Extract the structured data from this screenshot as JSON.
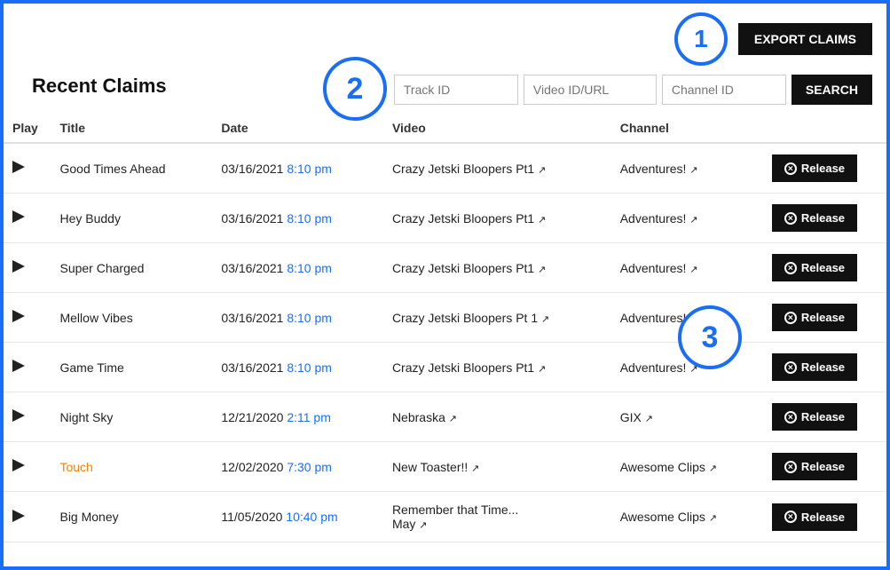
{
  "page": {
    "title": "Recent Claims",
    "badge1": "1",
    "badge2": "2",
    "badge3": "3"
  },
  "topbar": {
    "export_label": "EXPORT CLAIMS",
    "search_label": "SEARCH"
  },
  "search": {
    "track_id_placeholder": "Track ID",
    "video_id_placeholder": "Video ID/URL",
    "channel_id_placeholder": "Channel ID"
  },
  "table": {
    "headers": [
      "Play",
      "Title",
      "Date",
      "Video",
      "Channel",
      ""
    ],
    "rows": [
      {
        "title": "Good Times Ahead",
        "title_color": "normal",
        "date_part1": "03/16/2021",
        "date_part2": "8:10 pm",
        "video_line1": "Crazy Jetski Bloopers Pt1",
        "channel": "Adventures!",
        "action": "Release"
      },
      {
        "title": "Hey Buddy",
        "title_color": "normal",
        "date_part1": "03/16/2021",
        "date_part2": "8:10 pm",
        "video_line1": "Crazy Jetski Bloopers Pt1",
        "channel": "Adventures!",
        "action": "Release"
      },
      {
        "title": "Super Charged",
        "title_color": "normal",
        "date_part1": "03/16/2021",
        "date_part2": "8:10 pm",
        "video_line1": "Crazy Jetski Bloopers Pt1",
        "channel": "Adventures!",
        "action": "Release"
      },
      {
        "title": "Mellow Vibes",
        "title_color": "normal",
        "date_part1": "03/16/2021",
        "date_part2": "8:10 pm",
        "video_line1": "Crazy Jetski Bloopers Pt 1",
        "channel": "Adventures!",
        "action": "Release"
      },
      {
        "title": "Game Time",
        "title_color": "normal",
        "date_part1": "03/16/2021",
        "date_part2": "8:10 pm",
        "video_line1": "Crazy Jetski Bloopers Pt1",
        "channel": "Adventures!",
        "action": "Release"
      },
      {
        "title": "Night Sky",
        "title_color": "normal",
        "date_part1": "12/21/2020",
        "date_part2": "2:11 pm",
        "video_line1": "Nebraska",
        "channel": "GIX",
        "action": "Release"
      },
      {
        "title": "Touch",
        "title_color": "orange",
        "date_part1": "12/02/2020",
        "date_part2": "7:30 pm",
        "video_line1": "New Toaster!!",
        "channel": "Awesome Clips",
        "action": "Release"
      },
      {
        "title": "Big Money",
        "title_color": "normal",
        "date_part1": "11/05/2020",
        "date_part2": "10:40 pm",
        "video_line1": "Remember that Time...",
        "video_line2": "May",
        "channel": "Awesome Clips",
        "action": "Release"
      }
    ]
  }
}
